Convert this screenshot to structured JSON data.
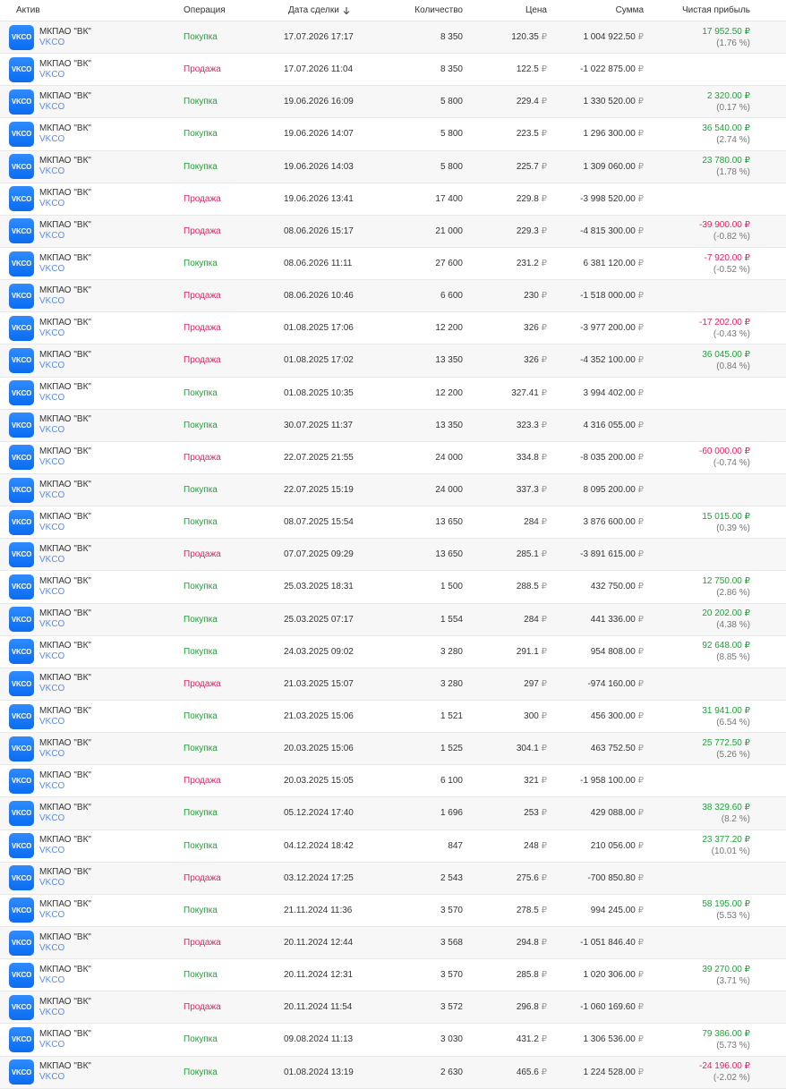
{
  "header": {
    "asset": "Актив",
    "operation": "Операция",
    "date": "Дата сделки",
    "qty": "Количество",
    "price": "Цена",
    "sum": "Сумма",
    "pnl": "Чистая прибыль",
    "sort_icon": "arrow-down-icon"
  },
  "currency": "₽",
  "colors": {
    "buy": "#21a038",
    "sell": "#e0245e",
    "ticker": "#5b8de4",
    "logo": "#0a6cf0"
  },
  "rows": [
    {
      "logo": "VKCO",
      "name": "МКПАО \"ВК\"",
      "ticker": "VKCO",
      "op": "Покупка",
      "type": "buy",
      "date": "17.07.2026 17:17",
      "qty": "8 350",
      "price": "120.35",
      "sum": "1 004 922.50",
      "pnl": "17 952.50",
      "pct": "(1.76 %)",
      "pnl_sign": "pos"
    },
    {
      "logo": "VKCO",
      "name": "МКПАО \"ВК\"",
      "ticker": "VKCO",
      "op": "Продажа",
      "type": "sell",
      "date": "17.07.2026 11:04",
      "qty": "8 350",
      "price": "122.5",
      "sum": "-1 022 875.00",
      "pnl": "",
      "pct": "",
      "pnl_sign": ""
    },
    {
      "logo": "VKCO",
      "name": "МКПАО \"ВК\"",
      "ticker": "VKCO",
      "op": "Покупка",
      "type": "buy",
      "date": "19.06.2026 16:09",
      "qty": "5 800",
      "price": "229.4",
      "sum": "1 330 520.00",
      "pnl": "2 320.00",
      "pct": "(0.17 %)",
      "pnl_sign": "pos"
    },
    {
      "logo": "VKCO",
      "name": "МКПАО \"ВК\"",
      "ticker": "VKCO",
      "op": "Покупка",
      "type": "buy",
      "date": "19.06.2026 14:07",
      "qty": "5 800",
      "price": "223.5",
      "sum": "1 296 300.00",
      "pnl": "36 540.00",
      "pct": "(2.74 %)",
      "pnl_sign": "pos"
    },
    {
      "logo": "VKCO",
      "name": "МКПАО \"ВК\"",
      "ticker": "VKCO",
      "op": "Покупка",
      "type": "buy",
      "date": "19.06.2026 14:03",
      "qty": "5 800",
      "price": "225.7",
      "sum": "1 309 060.00",
      "pnl": "23 780.00",
      "pct": "(1.78 %)",
      "pnl_sign": "pos"
    },
    {
      "logo": "VKCO",
      "name": "МКПАО \"ВК\"",
      "ticker": "VKCO",
      "op": "Продажа",
      "type": "sell",
      "date": "19.06.2026 13:41",
      "qty": "17 400",
      "price": "229.8",
      "sum": "-3 998 520.00",
      "pnl": "",
      "pct": "",
      "pnl_sign": ""
    },
    {
      "logo": "VKCO",
      "name": "МКПАО \"ВК\"",
      "ticker": "VKCO",
      "op": "Продажа",
      "type": "sell",
      "date": "08.06.2026 15:17",
      "qty": "21 000",
      "price": "229.3",
      "sum": "-4 815 300.00",
      "pnl": "-39 900.00",
      "pct": "(-0.82 %)",
      "pnl_sign": "neg"
    },
    {
      "logo": "VKCO",
      "name": "МКПАО \"ВК\"",
      "ticker": "VKCO",
      "op": "Покупка",
      "type": "buy",
      "date": "08.06.2026 11:11",
      "qty": "27 600",
      "price": "231.2",
      "sum": "6 381 120.00",
      "pnl": "-7 920.00",
      "pct": "(-0.52 %)",
      "pnl_sign": "neg"
    },
    {
      "logo": "VKCO",
      "name": "МКПАО \"ВК\"",
      "ticker": "VKCO",
      "op": "Продажа",
      "type": "sell",
      "date": "08.06.2026 10:46",
      "qty": "6 600",
      "price": "230",
      "sum": "-1 518 000.00",
      "pnl": "",
      "pct": "",
      "pnl_sign": ""
    },
    {
      "logo": "VKCO",
      "name": "МКПАО \"ВК\"",
      "ticker": "VKCO",
      "op": "Продажа",
      "type": "sell",
      "date": "01.08.2025 17:06",
      "qty": "12 200",
      "price": "326",
      "sum": "-3 977 200.00",
      "pnl": "-17 202.00",
      "pct": "(-0.43 %)",
      "pnl_sign": "neg"
    },
    {
      "logo": "VKCO",
      "name": "МКПАО \"ВК\"",
      "ticker": "VKCO",
      "op": "Продажа",
      "type": "sell",
      "date": "01.08.2025 17:02",
      "qty": "13 350",
      "price": "326",
      "sum": "-4 352 100.00",
      "pnl": "36 045.00",
      "pct": "(0.84 %)",
      "pnl_sign": "pos"
    },
    {
      "logo": "VKCO",
      "name": "МКПАО \"ВК\"",
      "ticker": "VKCO",
      "op": "Покупка",
      "type": "buy",
      "date": "01.08.2025 10:35",
      "qty": "12 200",
      "price": "327.41",
      "sum": "3 994 402.00",
      "pnl": "",
      "pct": "",
      "pnl_sign": ""
    },
    {
      "logo": "VKCO",
      "name": "МКПАО \"ВК\"",
      "ticker": "VKCO",
      "op": "Покупка",
      "type": "buy",
      "date": "30.07.2025 11:37",
      "qty": "13 350",
      "price": "323.3",
      "sum": "4 316 055.00",
      "pnl": "",
      "pct": "",
      "pnl_sign": ""
    },
    {
      "logo": "VKCO",
      "name": "МКПАО \"ВК\"",
      "ticker": "VKCO",
      "op": "Продажа",
      "type": "sell",
      "date": "22.07.2025 21:55",
      "qty": "24 000",
      "price": "334.8",
      "sum": "-8 035 200.00",
      "pnl": "-60 000.00",
      "pct": "(-0.74 %)",
      "pnl_sign": "neg"
    },
    {
      "logo": "VKCO",
      "name": "МКПАО \"ВК\"",
      "ticker": "VKCO",
      "op": "Покупка",
      "type": "buy",
      "date": "22.07.2025 15:19",
      "qty": "24 000",
      "price": "337.3",
      "sum": "8 095 200.00",
      "pnl": "",
      "pct": "",
      "pnl_sign": ""
    },
    {
      "logo": "VKCO",
      "name": "МКПАО \"ВК\"",
      "ticker": "VKCO",
      "op": "Покупка",
      "type": "buy",
      "date": "08.07.2025 15:54",
      "qty": "13 650",
      "price": "284",
      "sum": "3 876 600.00",
      "pnl": "15 015.00",
      "pct": "(0.39 %)",
      "pnl_sign": "pos"
    },
    {
      "logo": "VKCO",
      "name": "МКПАО \"ВК\"",
      "ticker": "VKCO",
      "op": "Продажа",
      "type": "sell",
      "date": "07.07.2025 09:29",
      "qty": "13 650",
      "price": "285.1",
      "sum": "-3 891 615.00",
      "pnl": "",
      "pct": "",
      "pnl_sign": ""
    },
    {
      "logo": "VKCO",
      "name": "МКПАО \"ВК\"",
      "ticker": "VKCO",
      "op": "Покупка",
      "type": "buy",
      "date": "25.03.2025 18:31",
      "qty": "1 500",
      "price": "288.5",
      "sum": "432 750.00",
      "pnl": "12 750.00",
      "pct": "(2.86 %)",
      "pnl_sign": "pos"
    },
    {
      "logo": "VKCO",
      "name": "МКПАО \"ВК\"",
      "ticker": "VKCO",
      "op": "Покупка",
      "type": "buy",
      "date": "25.03.2025 07:17",
      "qty": "1 554",
      "price": "284",
      "sum": "441 336.00",
      "pnl": "20 202.00",
      "pct": "(4.38 %)",
      "pnl_sign": "pos"
    },
    {
      "logo": "VKCO",
      "name": "МКПАО \"ВК\"",
      "ticker": "VKCO",
      "op": "Покупка",
      "type": "buy",
      "date": "24.03.2025 09:02",
      "qty": "3 280",
      "price": "291.1",
      "sum": "954 808.00",
      "pnl": "92 648.00",
      "pct": "(8.85 %)",
      "pnl_sign": "pos"
    },
    {
      "logo": "VKCO",
      "name": "МКПАО \"ВК\"",
      "ticker": "VKCO",
      "op": "Продажа",
      "type": "sell",
      "date": "21.03.2025 15:07",
      "qty": "3 280",
      "price": "297",
      "sum": "-974 160.00",
      "pnl": "",
      "pct": "",
      "pnl_sign": ""
    },
    {
      "logo": "VKCO",
      "name": "МКПАО \"ВК\"",
      "ticker": "VKCO",
      "op": "Покупка",
      "type": "buy",
      "date": "21.03.2025 15:06",
      "qty": "1 521",
      "price": "300",
      "sum": "456 300.00",
      "pnl": "31 941.00",
      "pct": "(6.54 %)",
      "pnl_sign": "pos"
    },
    {
      "logo": "VKCO",
      "name": "МКПАО \"ВК\"",
      "ticker": "VKCO",
      "op": "Покупка",
      "type": "buy",
      "date": "20.03.2025 15:06",
      "qty": "1 525",
      "price": "304.1",
      "sum": "463 752.50",
      "pnl": "25 772.50",
      "pct": "(5.26 %)",
      "pnl_sign": "pos"
    },
    {
      "logo": "VKCO",
      "name": "МКПАО \"ВК\"",
      "ticker": "VKCO",
      "op": "Продажа",
      "type": "sell",
      "date": "20.03.2025 15:05",
      "qty": "6 100",
      "price": "321",
      "sum": "-1 958 100.00",
      "pnl": "",
      "pct": "",
      "pnl_sign": ""
    },
    {
      "logo": "VKCO",
      "name": "МКПАО \"ВК\"",
      "ticker": "VKCO",
      "op": "Покупка",
      "type": "buy",
      "date": "05.12.2024 17:40",
      "qty": "1 696",
      "price": "253",
      "sum": "429 088.00",
      "pnl": "38 329.60",
      "pct": "(8.2 %)",
      "pnl_sign": "pos"
    },
    {
      "logo": "VKCO",
      "name": "МКПАО \"ВК\"",
      "ticker": "VKCO",
      "op": "Покупка",
      "type": "buy",
      "date": "04.12.2024 18:42",
      "qty": "847",
      "price": "248",
      "sum": "210 056.00",
      "pnl": "23 377.20",
      "pct": "(10.01 %)",
      "pnl_sign": "pos"
    },
    {
      "logo": "VKCO",
      "name": "МКПАО \"ВК\"",
      "ticker": "VKCO",
      "op": "Продажа",
      "type": "sell",
      "date": "03.12.2024 17:25",
      "qty": "2 543",
      "price": "275.6",
      "sum": "-700 850.80",
      "pnl": "",
      "pct": "",
      "pnl_sign": ""
    },
    {
      "logo": "VKCO",
      "name": "МКПАО \"ВК\"",
      "ticker": "VKCO",
      "op": "Покупка",
      "type": "buy",
      "date": "21.11.2024 11:36",
      "qty": "3 570",
      "price": "278.5",
      "sum": "994 245.00",
      "pnl": "58 195.00",
      "pct": "(5.53 %)",
      "pnl_sign": "pos"
    },
    {
      "logo": "VKCO",
      "name": "МКПАО \"ВК\"",
      "ticker": "VKCO",
      "op": "Продажа",
      "type": "sell",
      "date": "20.11.2024 12:44",
      "qty": "3 568",
      "price": "294.8",
      "sum": "-1 051 846.40",
      "pnl": "",
      "pct": "",
      "pnl_sign": ""
    },
    {
      "logo": "VKCO",
      "name": "МКПАО \"ВК\"",
      "ticker": "VKCO",
      "op": "Покупка",
      "type": "buy",
      "date": "20.11.2024 12:31",
      "qty": "3 570",
      "price": "285.8",
      "sum": "1 020 306.00",
      "pnl": "39 270.00",
      "pct": "(3.71 %)",
      "pnl_sign": "pos"
    },
    {
      "logo": "VKCO",
      "name": "МКПАО \"ВК\"",
      "ticker": "VKCO",
      "op": "Продажа",
      "type": "sell",
      "date": "20.11.2024 11:54",
      "qty": "3 572",
      "price": "296.8",
      "sum": "-1 060 169.60",
      "pnl": "",
      "pct": "",
      "pnl_sign": ""
    },
    {
      "logo": "VKCO",
      "name": "МКПАО \"ВК\"",
      "ticker": "VKCO",
      "op": "Покупка",
      "type": "buy",
      "date": "09.08.2024 11:13",
      "qty": "3 030",
      "price": "431.2",
      "sum": "1 306 536.00",
      "pnl": "79 386.00",
      "pct": "(5.73 %)",
      "pnl_sign": "pos"
    },
    {
      "logo": "VKCO",
      "name": "МКПАО \"ВК\"",
      "ticker": "VKCO",
      "op": "Покупка",
      "type": "buy",
      "date": "01.08.2024 13:19",
      "qty": "2 630",
      "price": "465.6",
      "sum": "1 224 528.00",
      "pnl": "-24 196.00",
      "pct": "(-2.02 %)",
      "pnl_sign": "neg"
    }
  ]
}
